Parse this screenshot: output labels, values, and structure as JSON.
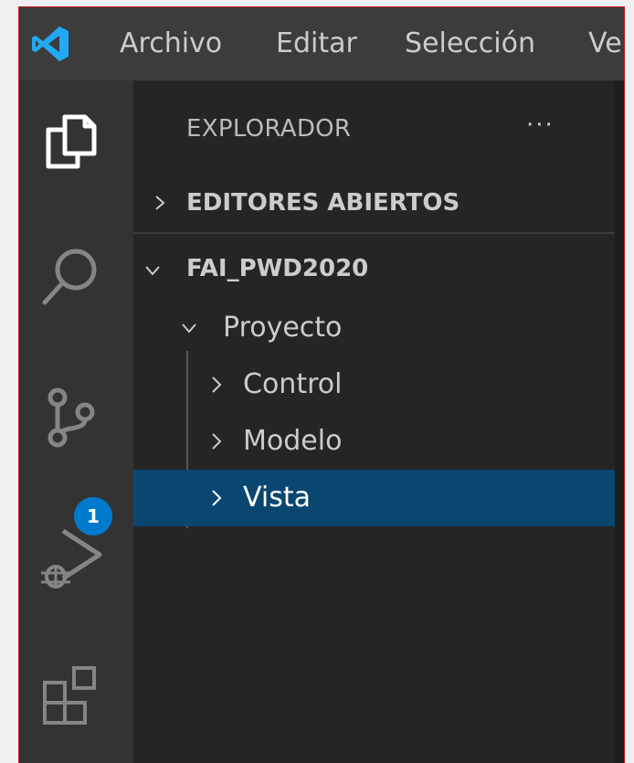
{
  "titlebar": {
    "logo_icon": "vscode-logo-icon",
    "menu": [
      "Archivo",
      "Editar",
      "Selección",
      "Ve"
    ]
  },
  "activitybar": {
    "items": [
      {
        "icon": "files-icon"
      },
      {
        "icon": "search-icon"
      },
      {
        "icon": "source-control-icon",
        "badge": "1"
      },
      {
        "icon": "run-debug-icon"
      },
      {
        "icon": "extensions-icon"
      }
    ]
  },
  "sidebar": {
    "title": "EXPLORADOR",
    "more": "···",
    "open_editors": "EDITORES ABIERTOS",
    "workspace": "FAI_PWD2020",
    "tree": [
      {
        "label": "Proyecto",
        "expanded": true
      },
      {
        "label": "Control",
        "expanded": false
      },
      {
        "label": "Modelo",
        "expanded": false
      },
      {
        "label": "Vista",
        "expanded": false,
        "selected": true
      }
    ]
  },
  "colors": {
    "titlebar": "#3c3c3c",
    "activitybar": "#333333",
    "sidebar": "#252526",
    "selection": "#094771",
    "badge": "#007acc",
    "logo": "#23a9f2"
  }
}
